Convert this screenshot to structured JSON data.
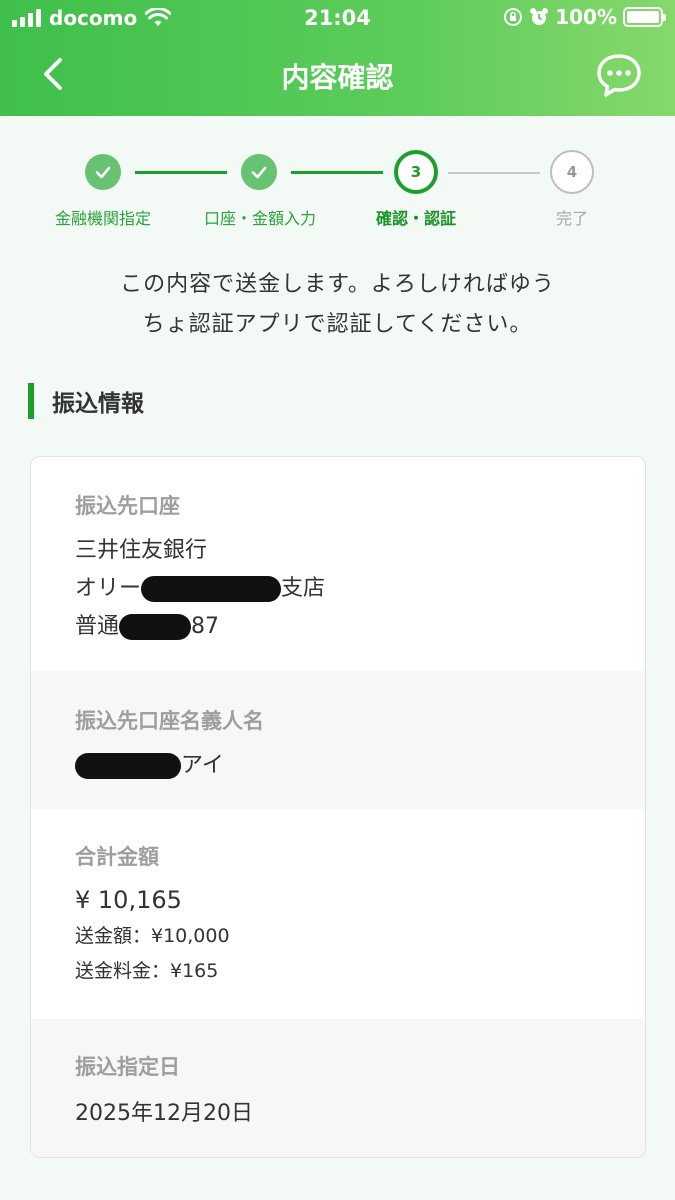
{
  "status_bar": {
    "carrier": "docomo",
    "time": "21:04",
    "battery": "100%"
  },
  "nav": {
    "title": "内容確認",
    "back_icon": "chevron-left-icon",
    "chat_icon": "chat-bubble-icon"
  },
  "stepper": {
    "steps": [
      {
        "label": "金融機関指定",
        "state": "done"
      },
      {
        "label": "口座・金額入力",
        "state": "done"
      },
      {
        "label": "確認・認証",
        "state": "current",
        "number": "3"
      },
      {
        "label": "完了",
        "state": "future",
        "number": "4"
      }
    ]
  },
  "message": {
    "line1": "この内容で送金します。よろしければゆう",
    "line2": "ちょ認証アプリで認証してください。"
  },
  "section": {
    "title": "振込情報"
  },
  "transfer": {
    "account": {
      "label": "振込先口座",
      "bank": "三井住友銀行",
      "branch_prefix": "オリー",
      "branch_suffix": "支店",
      "type_prefix": "普通",
      "number_suffix": "87"
    },
    "holder": {
      "label": "振込先口座名義人名",
      "name_suffix": "アイ"
    },
    "total": {
      "label": "合計金額",
      "amount": "¥ 10,165",
      "send_amount": "送金額：¥10,000",
      "fee": "送金料金：¥165"
    },
    "date": {
      "label": "振込指定日",
      "value": "2025年12月20日"
    }
  },
  "colors": {
    "brand_green": "#1aa02a",
    "header_start": "#3fbf4b",
    "header_end": "#86d86b"
  }
}
